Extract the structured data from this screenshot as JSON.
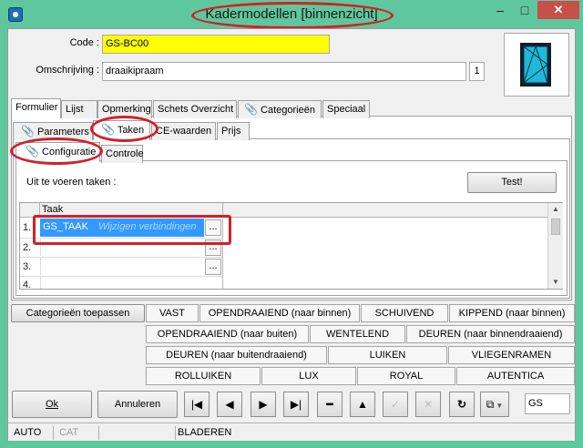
{
  "window": {
    "title": "Kadermodellen [binnenzicht]"
  },
  "title_buttons": {
    "minimize": "–",
    "maximize": "□",
    "close": "✕"
  },
  "form": {
    "code_label": "Code :",
    "code_value": "GS-BC00",
    "omschrijving_label": "Omschrijving :",
    "omschrijving_value": "draaikipraam",
    "count": "1"
  },
  "main_tabs": [
    "Formulier",
    "Lijst",
    "Opmerking",
    "Schets Overzicht",
    "Categorieën",
    "Speciaal"
  ],
  "sub_tabs": [
    "Parameters",
    "Taken",
    "CE-waarden",
    "Prijs"
  ],
  "sub_sub_tabs": [
    "Configuratie",
    "Controle"
  ],
  "tasks": {
    "label": "Uit te voeren taken :",
    "test_button": "Test!",
    "column_header": "Taak",
    "rows": [
      {
        "num": "1.",
        "value": "GS_TAAK",
        "hint": "Wijzigen verbindingen",
        "button": "..."
      },
      {
        "num": "2.",
        "value": "",
        "hint": "",
        "button": "..."
      },
      {
        "num": "3.",
        "value": "",
        "hint": "",
        "button": "..."
      },
      {
        "num": "4.",
        "value": "",
        "hint": "",
        "button": ""
      }
    ]
  },
  "categories_button": "Categorieën toepassen",
  "category_rows": [
    [
      "VAST",
      "OPENDRAAIEND (naar binnen)",
      "SCHUIVEND",
      "KIPPEND (naar binnen)"
    ],
    [
      "OPENDRAAIEND (naar buiten)",
      "WENTELEND",
      "DEUREN (naar binnendraaiend)"
    ],
    [
      "DEUREN (naar buitendraaiend)",
      "LUIKEN",
      "VLIEGENRAMEN"
    ],
    [
      "ROLLUIKEN",
      "LUX",
      "ROYAL",
      "AUTENTICA"
    ]
  ],
  "footer": {
    "ok": "Ok",
    "cancel": "Annuleren",
    "search_value": "GS"
  },
  "statusbar": {
    "mode1": "AUTO",
    "mode2": "CAT",
    "mode3": "BLADEREN"
  },
  "colors": {
    "accent": "#3399ff",
    "highlight_field": "#ffff00",
    "annotation": "#d0202a",
    "frame": "#5fc79d"
  },
  "icons": {
    "thumbnail": "window-frame-icon",
    "attachment": "paperclip-icon"
  }
}
